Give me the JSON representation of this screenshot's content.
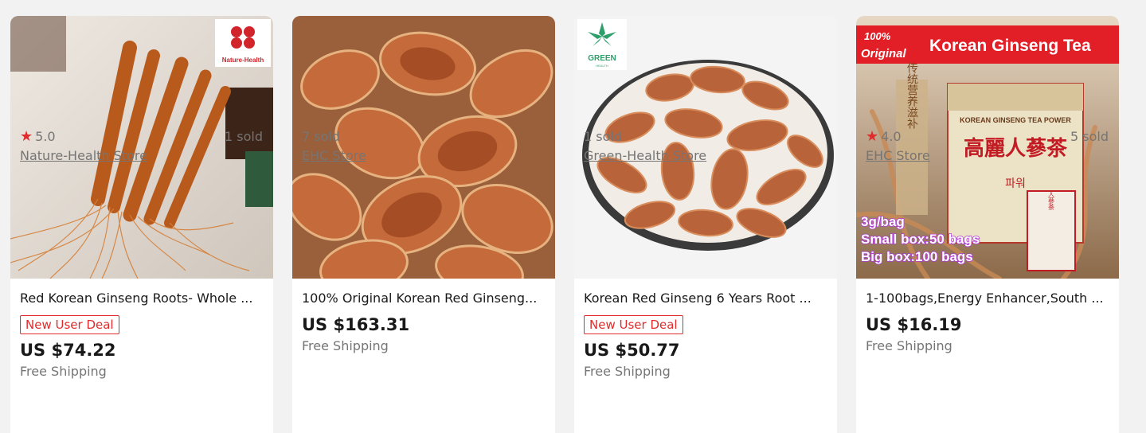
{
  "products": [
    {
      "title": "Red Korean Ginseng Roots- Whole ...",
      "badge": "New User Deal",
      "price": "US $74.22",
      "shipping": "Free Shipping",
      "rating": "5.0",
      "sold": "1 sold",
      "store": "Nature-Health Store",
      "image_logo": "Nature-Health"
    },
    {
      "title": "100% Original Korean Red Ginseng...",
      "price": "US $163.31",
      "shipping": "Free Shipping",
      "sold": "7 sold",
      "store": "EHC Store"
    },
    {
      "title": "Korean Red Ginseng 6 Years Root ...",
      "badge": "New User Deal",
      "price": "US $50.77",
      "shipping": "Free Shipping",
      "sold": "1 sold",
      "store": "Green-Health Store",
      "image_logo": "GREEN",
      "image_logo_sub": "HEALTH"
    },
    {
      "title": "1-100bags,Energy Enhancer,South ...",
      "price": "US $16.19",
      "shipping": "Free Shipping",
      "rating": "4.0",
      "sold": "5 sold",
      "store": "EHC Store",
      "image_banner": "Korean Ginseng Tea",
      "image_banner_tag_1": "100%",
      "image_banner_tag_2": "Original",
      "image_box_title": "KOREAN GINSENG TEA POWER",
      "image_box_hanja": "高麗人蔘茶",
      "image_box_hangul": "파워",
      "image_side_text": "传统营养滋补",
      "image_packet_text": "人蔘茶",
      "image_caption_1": "3g/bag",
      "image_caption_2": "Small box:50 bags",
      "image_caption_3": "Big box:100 bags"
    }
  ],
  "colors": {
    "accent_red": "#e02c2c",
    "text_dark": "#191919",
    "text_muted": "#757575",
    "page_bg": "#f2f2f2"
  },
  "icons": {
    "rating": "star-icon"
  }
}
